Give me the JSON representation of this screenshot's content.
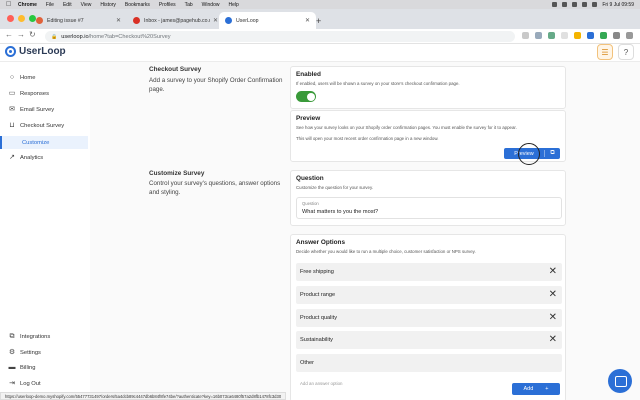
{
  "menubar": {
    "app": "Chrome",
    "items": [
      "File",
      "Edit",
      "View",
      "History",
      "Bookmarks",
      "Profiles",
      "Tab",
      "Window",
      "Help"
    ],
    "clock": "Fri 9 Jul 09:59"
  },
  "tabs": [
    {
      "label": "Editing issue #7",
      "favicon_color": "#e0623a"
    },
    {
      "label": "Inbox - james@pagehub.co.uk",
      "favicon_color": "#d93025"
    },
    {
      "label": "UserLoop",
      "favicon_color": "#2b6fd6"
    }
  ],
  "address": {
    "host": "userloop.io",
    "path": "/home?tab=Checkout%20Survey"
  },
  "app": {
    "logo": "UserLoop",
    "accent": "#2b6fd6"
  },
  "sidebar": {
    "items": [
      {
        "label": "Home",
        "icon": "home-icon"
      },
      {
        "label": "Responses",
        "icon": "inbox-icon"
      },
      {
        "label": "Email Survey",
        "icon": "mail-icon"
      },
      {
        "label": "Checkout Survey",
        "icon": "cart-icon"
      },
      {
        "label": "Customize",
        "icon": ""
      },
      {
        "label": "Analytics",
        "icon": "chart-icon"
      }
    ],
    "bottom": [
      {
        "label": "Integrations",
        "icon": "puzzle-icon"
      },
      {
        "label": "Settings",
        "icon": "gear-icon"
      },
      {
        "label": "Billing",
        "icon": "card-icon"
      },
      {
        "label": "Log Out",
        "icon": "logout-icon"
      }
    ]
  },
  "checkout_section": {
    "title": "Checkout Survey",
    "description": "Add a survey to your Shopify Order Confirmation page."
  },
  "enabled_card": {
    "title": "Enabled",
    "description": "If enabled, users will be shown a survey on your store's checkout confirmation page.",
    "enabled": true
  },
  "preview_card": {
    "title": "Preview",
    "description": "See how your survey looks on your Shopify order confirmation pages.  You must enable the survey for it to appear.",
    "note": "This will open your most recent order confirmation page in a new window.",
    "button_label": "Preview"
  },
  "customize_section": {
    "title": "Customize Survey",
    "description": "Control your survey's questions, answer options and styling."
  },
  "question_card": {
    "title": "Question",
    "description": "Customize the question for your survey.",
    "field_label": "Question",
    "field_value": "What matters to you the most?"
  },
  "answers_card": {
    "title": "Answer Options",
    "description": "Decide whether you would like to run a multiple choice, customer satisfaction or NPS survey.",
    "options": [
      {
        "label": "Free shipping",
        "removable": true
      },
      {
        "label": "Product range",
        "removable": true
      },
      {
        "label": "Product quality",
        "removable": true
      },
      {
        "label": "Sustainability",
        "removable": true
      },
      {
        "label": "Other",
        "removable": false
      }
    ],
    "add_placeholder": "Add an answer option",
    "add_button": "Add"
  },
  "status_url": "https://userloop-demo.myshopify.com/55477731497/orders/5a4dcb89c4447db6b84f8fe74be/?authenticate?key=16b073ca6480f57a2d8fb1478fc3d30"
}
